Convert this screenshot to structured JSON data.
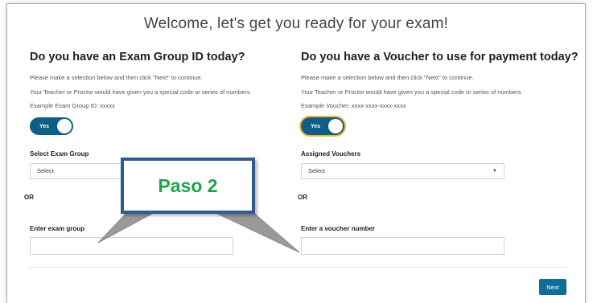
{
  "page": {
    "welcome": "Welcome, let's get you ready for your exam!"
  },
  "left": {
    "heading": "Do you have an Exam Group ID today?",
    "hint_1": "Please make a selection below and then click \"Next\" to continue.",
    "hint_2": "Your Teacher or Proctor would have given you a special code or series of numbers.",
    "hint_3": "Example Exam Group ID: xxxxx",
    "toggle_label": "Yes",
    "select_label": "Select Exam Group",
    "select_value": "Select",
    "or_text": "OR",
    "input_label": "Enter exam group",
    "input_value": ""
  },
  "right": {
    "heading": "Do you have a Voucher to use for payment today?",
    "hint_1": "Please make a selection below and then click \"Next\" to continue.",
    "hint_2": "Your Teacher or Proctor would have given you a special code or series of numbers.",
    "hint_3": "Example Voucher: xxxx-xxxx-xxxx-xxxx",
    "toggle_label": "Yes",
    "select_label": "Assigned Vouchers",
    "select_value": "Select",
    "or_text": "OR",
    "input_label": "Enter a voucher number",
    "input_value": ""
  },
  "footer": {
    "next_label": "Next"
  },
  "callout": {
    "text": "Paso 2"
  },
  "colors": {
    "toggle_bg": "#0d5f86",
    "button_bg": "#0d6f99",
    "callout_border": "#315a8e",
    "callout_text": "#22a24a",
    "highlight": "#f2b73a"
  }
}
